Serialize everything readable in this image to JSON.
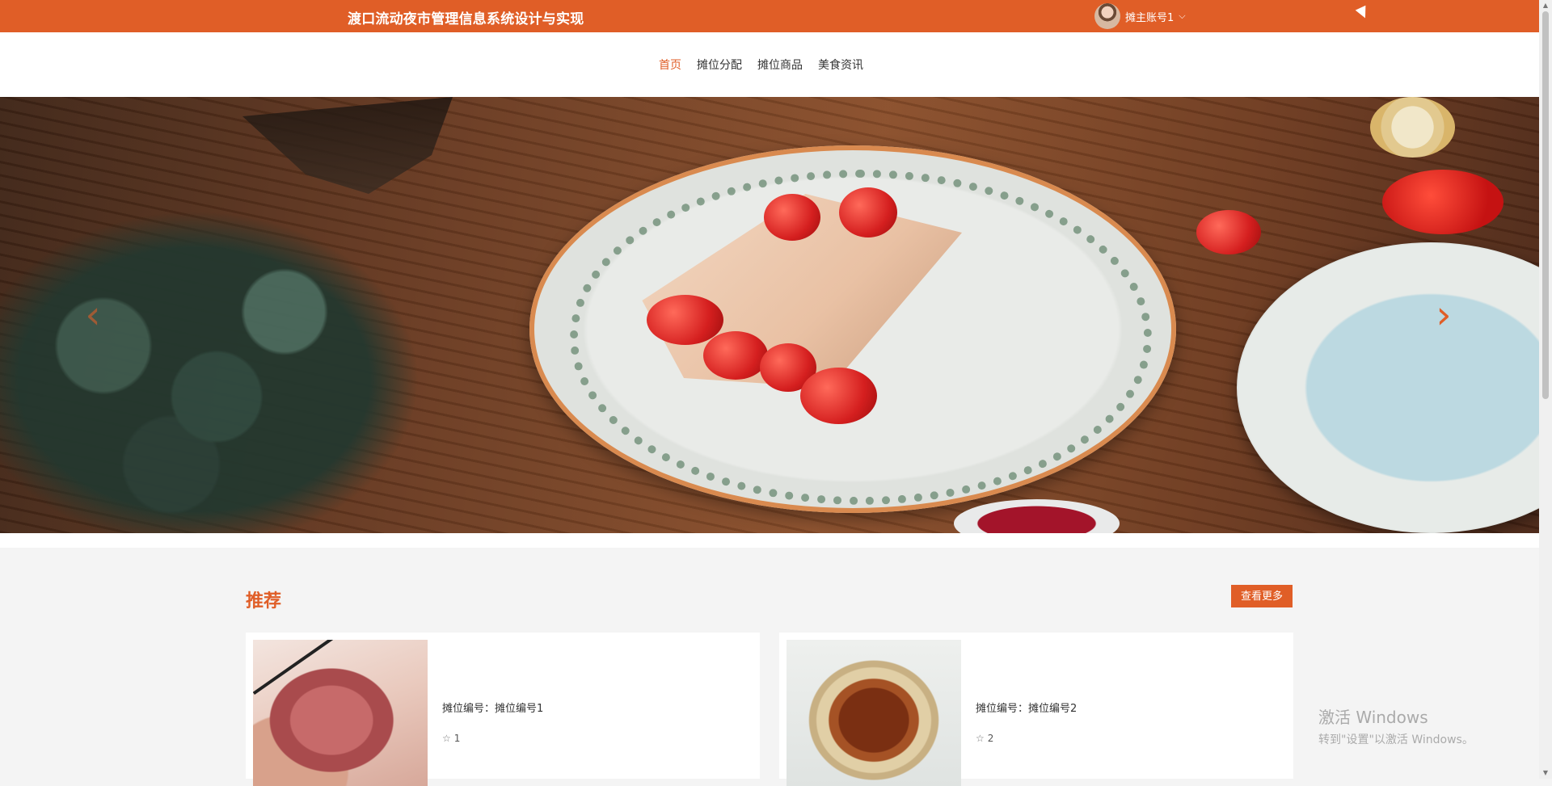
{
  "app": {
    "title": "渡口流动夜市管理信息系统设计与实现"
  },
  "user": {
    "name": "摊主账号1",
    "chevron": "⌵"
  },
  "nav": {
    "items": [
      {
        "label": "首页",
        "active": true
      },
      {
        "label": "摊位分配"
      },
      {
        "label": "摊位商品"
      },
      {
        "label": "美食资讯"
      }
    ]
  },
  "banner": {
    "prev_icon": "‹",
    "next_icon": "›"
  },
  "recommend": {
    "title": "推荐",
    "more_label": "查看更多",
    "cards": [
      {
        "text": "摊位编号：摊位编号1",
        "rating": "1",
        "star": "☆"
      },
      {
        "text": "摊位编号：摊位编号2",
        "rating": "2",
        "star": "☆"
      }
    ]
  },
  "watermark": {
    "line1": "激活 Windows",
    "line2": "转到\"设置\"以激活 Windows。"
  },
  "colors": {
    "brand": "#e05e27"
  }
}
